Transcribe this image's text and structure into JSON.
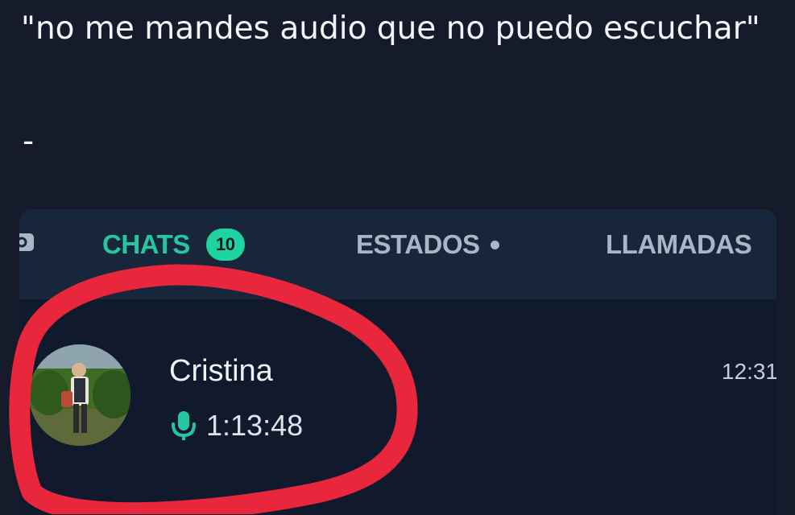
{
  "post": {
    "caption": "\"no me mandes audio que no puedo escuchar\"",
    "separator": "-"
  },
  "whatsapp": {
    "tabs": [
      {
        "label": "CHATS",
        "badge": "10",
        "active": true
      },
      {
        "label": "ESTADOS",
        "has_dot": true
      },
      {
        "label": "LLAMADAS"
      }
    ],
    "chats": [
      {
        "name": "Cristina",
        "preview_icon": "mic-icon",
        "audio_duration": "1:13:48",
        "time": "12:31"
      }
    ]
  },
  "colors": {
    "background": "#151b2b",
    "tab_bar": "#17263b",
    "accent": "#25c7a1",
    "badge": "#1ed3a0",
    "inactive_tab": "#a9b6c5",
    "highlight_circle": "#e8273d"
  }
}
